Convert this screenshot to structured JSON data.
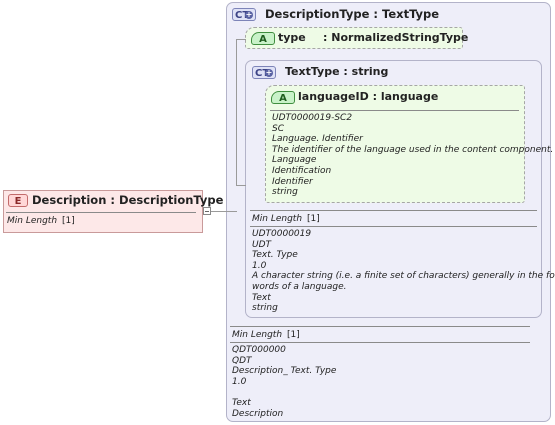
{
  "element": {
    "tag": "E",
    "name": "Description",
    "sep": ":",
    "type": "DescriptionType",
    "facet_label": "Min Length",
    "facet_value": "[1]"
  },
  "outer_ct": {
    "tag": "CT",
    "name": "DescriptionType",
    "sep": ":",
    "type": "TextType",
    "attribute": {
      "tag": "A",
      "name": "type",
      "sep": ":",
      "type": "NormalizedStringType"
    },
    "facet_label": "Min Length",
    "facet_value": "[1]",
    "doc": [
      "QDT000000",
      "QDT",
      "Description_ Text. Type",
      "1.0",
      "",
      "Text",
      "Description"
    ]
  },
  "inner_ct": {
    "tag": "CT",
    "name": "TextType",
    "sep": ":",
    "type": "string",
    "attribute": {
      "tag": "A",
      "name": "languageID",
      "sep": ":",
      "type": "language",
      "doc": [
        "UDT0000019-SC2",
        "SC",
        "Language. Identifier",
        "The identifier of the language used in the content component.",
        "Language",
        "Identification",
        "Identifier",
        "string"
      ]
    },
    "facet_label": "Min Length",
    "facet_value": "[1]",
    "doc": [
      "UDT0000019",
      "UDT",
      "Text. Type",
      "1.0",
      "A character string (i.e. a finite set of characters) generally in the form of",
      "words of a language.",
      "Text",
      "string"
    ]
  },
  "colors": {
    "ct_panel": "#eeeef9",
    "ct_border": "#b3b3c9",
    "attr_fill": "#eefbe6",
    "attr_border": "#a6a6a6",
    "element_fill": "#fde8e8",
    "element_border": "#c99a9a"
  }
}
